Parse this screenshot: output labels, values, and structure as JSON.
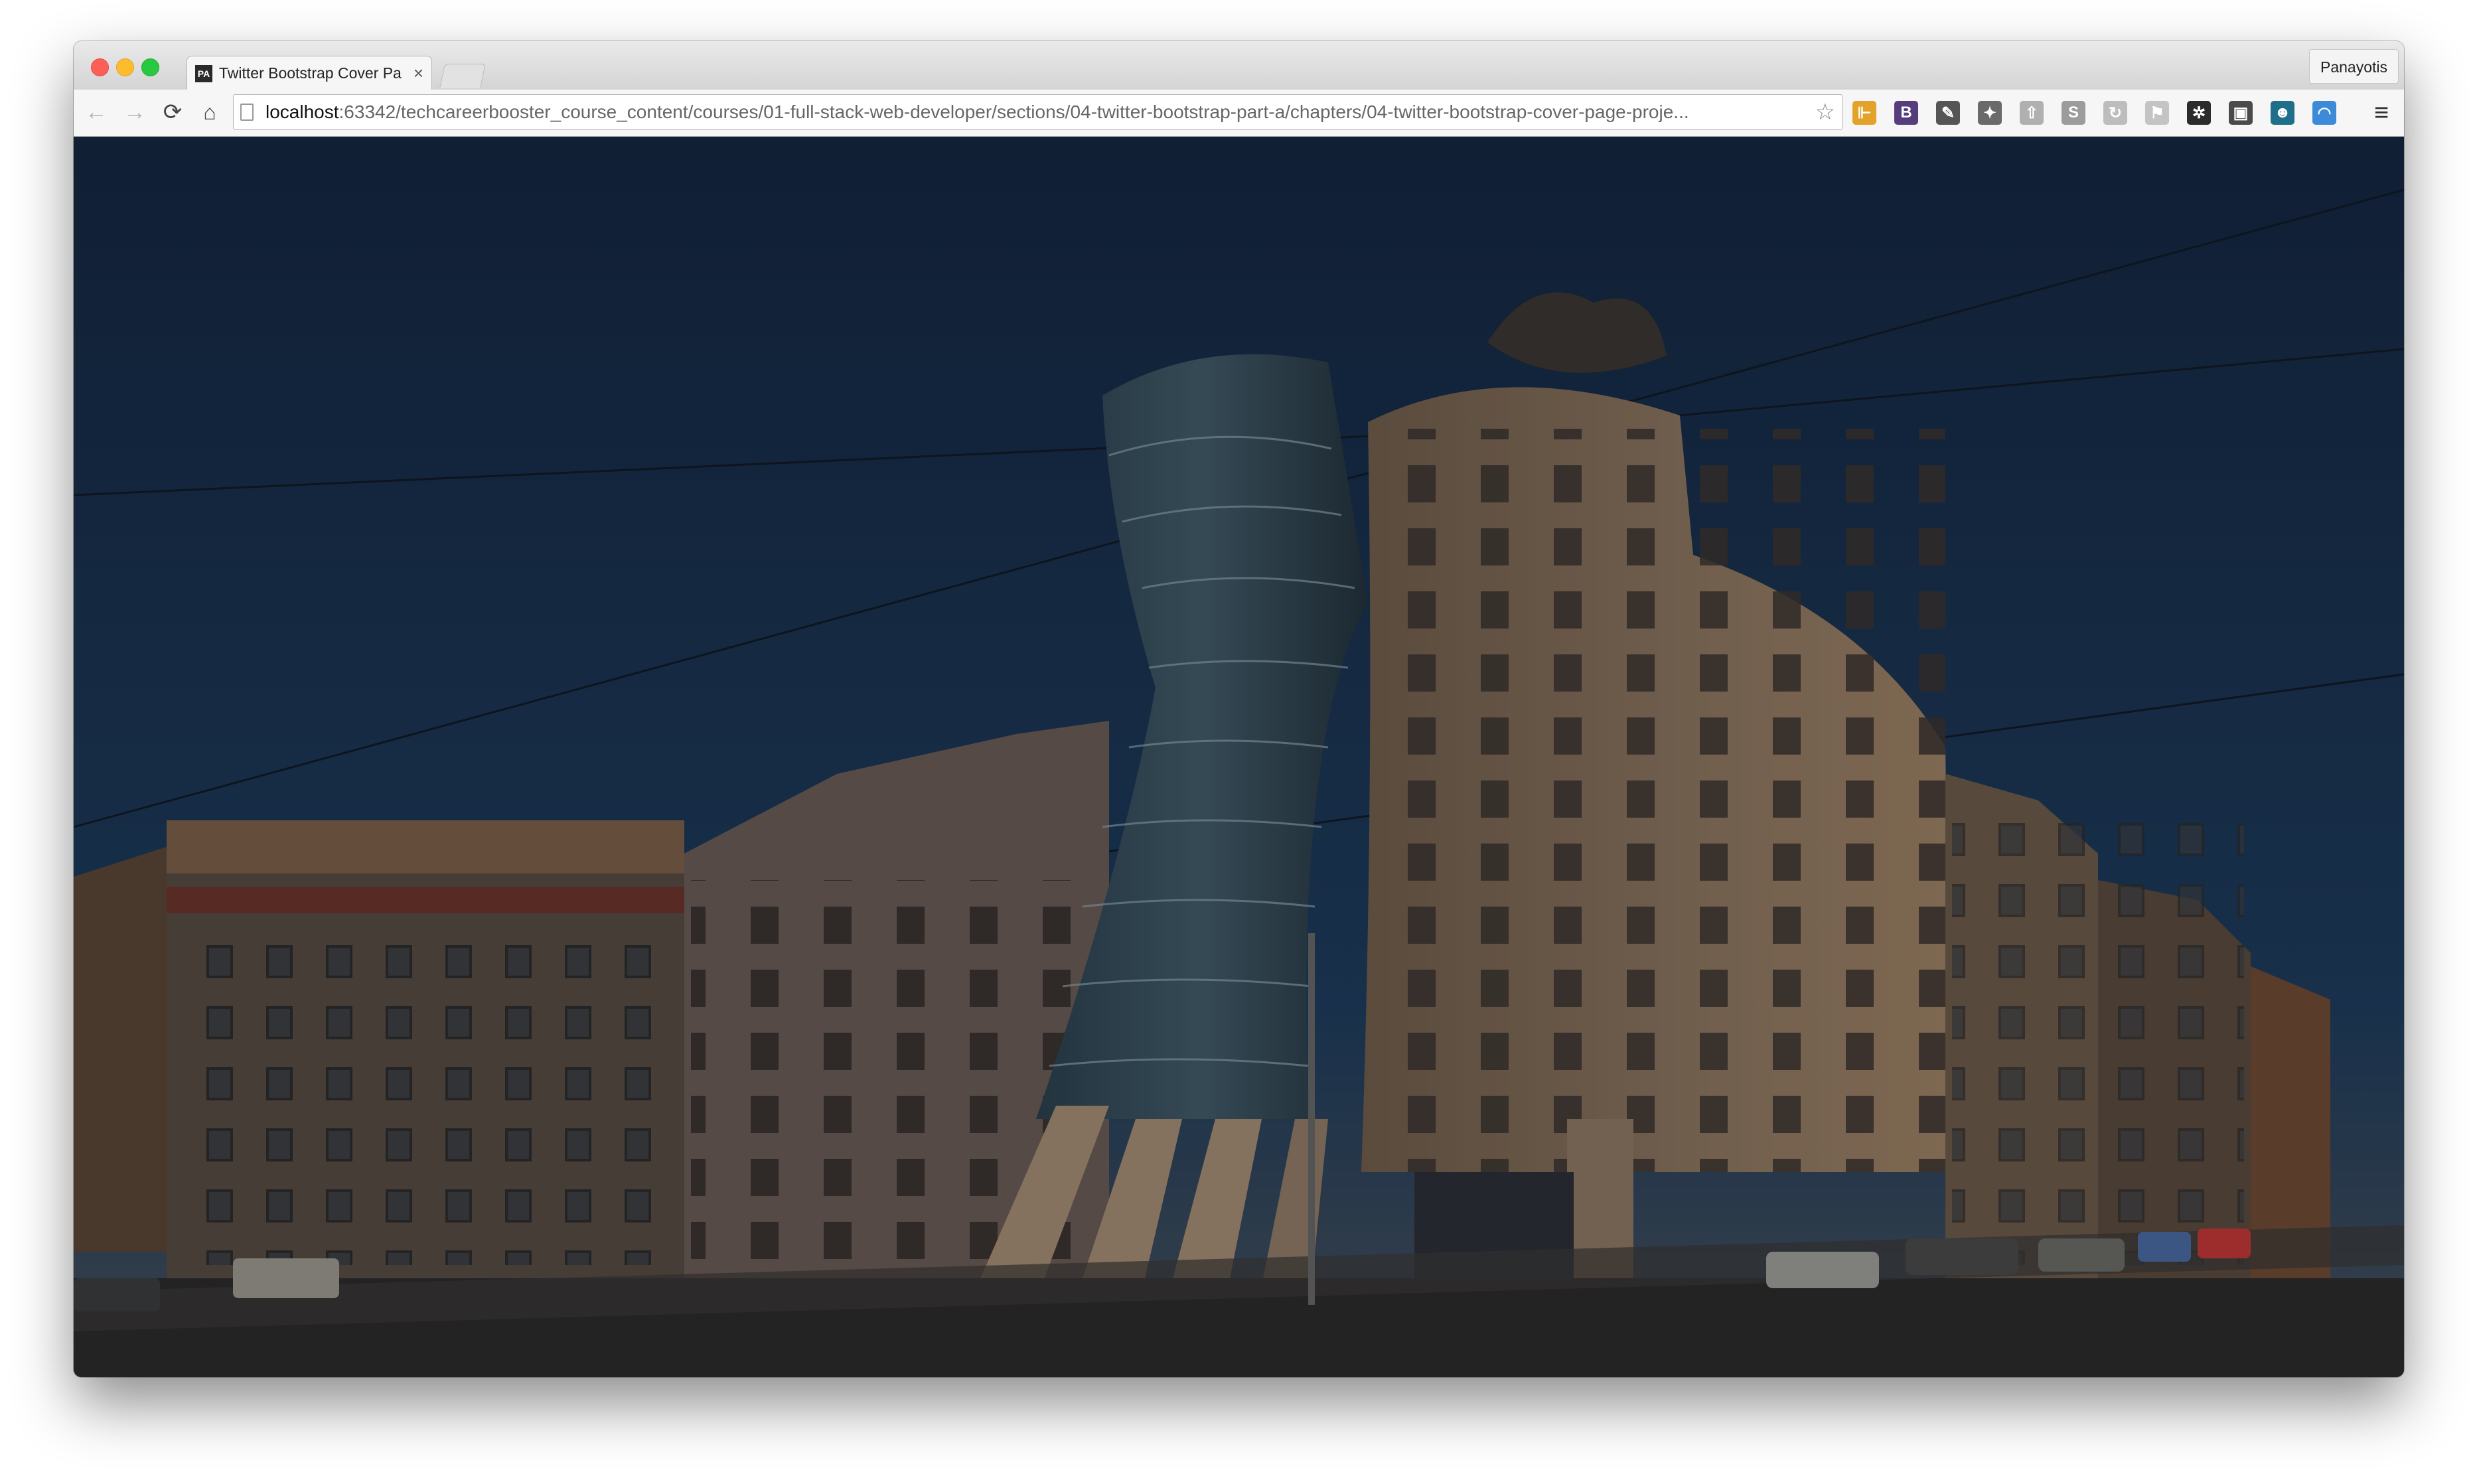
{
  "tab": {
    "title": "Twitter Bootstrap Cover Pa",
    "close_glyph": "×",
    "favicon_text": "PA"
  },
  "profile": {
    "name": "Panayotis"
  },
  "toolbar": {
    "back_glyph": "←",
    "forward_glyph": "→",
    "reload_glyph": "⟳",
    "home_glyph": "⌂",
    "star_glyph": "☆",
    "menu_glyph": "≡"
  },
  "address_bar": {
    "host": "localhost",
    "path": ":63342/techcareerbooster_course_content/courses/01-full-stack-web-developer/sections/04-twitter-bootstrap-part-a/chapters/04-twitter-bootstrap-cover-page-proje..."
  },
  "extensions": [
    {
      "name": "bookmark-extension-icon",
      "glyph": "⊩",
      "color": "#e3a32b"
    },
    {
      "name": "bootstrap-extension-icon",
      "glyph": "B",
      "color": "#563d7c"
    },
    {
      "name": "eyedropper-extension-icon",
      "glyph": "✎",
      "color": "#555555"
    },
    {
      "name": "evernote-extension-icon",
      "glyph": "✦",
      "color": "#6a6a6a"
    },
    {
      "name": "pushbullet-extension-icon",
      "glyph": "⇧",
      "color": "#b0b0b0"
    },
    {
      "name": "skype-extension-icon",
      "glyph": "S",
      "color": "#9c9c9c"
    },
    {
      "name": "sync-extension-icon",
      "glyph": "↻",
      "color": "#bdbdbd"
    },
    {
      "name": "flag-extension-icon",
      "glyph": "⚑",
      "color": "#c4c4c4"
    },
    {
      "name": "aperture-extension-icon",
      "glyph": "✲",
      "color": "#2b2b2b"
    },
    {
      "name": "window-extension-icon",
      "glyph": "▣",
      "color": "#4a4a4a"
    },
    {
      "name": "user-extension-icon",
      "glyph": "☻",
      "color": "#1f6f8b"
    },
    {
      "name": "gradient-extension-icon",
      "glyph": "◠",
      "color": "#3c8ad8"
    }
  ],
  "page": {
    "description_hidden": "",
    "colors": {
      "sky_top": "#14263f",
      "sky_bottom": "#263f57",
      "building_glass": "#2f4655",
      "building_concrete": "#7d6a57"
    }
  }
}
